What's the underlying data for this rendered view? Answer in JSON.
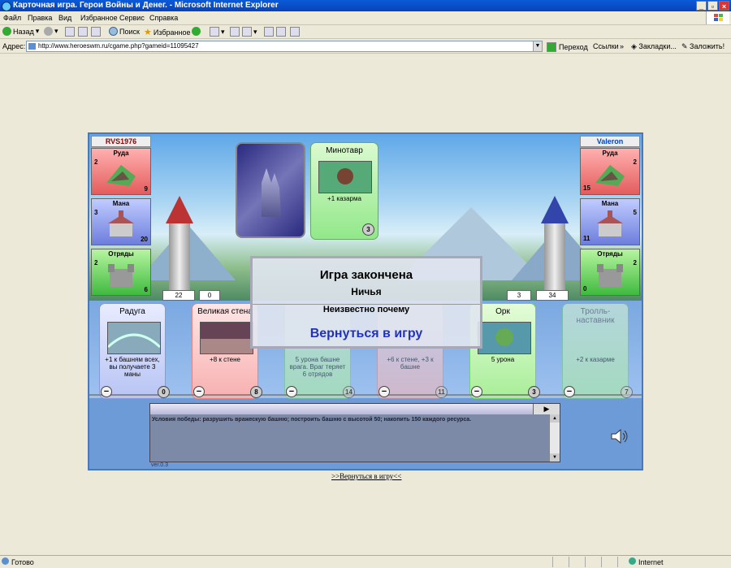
{
  "window": {
    "title": "Карточная игра. Герои Войны и Денег. - Microsoft Internet Explorer"
  },
  "menu": [
    "Файл",
    "Правка",
    "Вид",
    "Избранное",
    "Сервис",
    "Справка"
  ],
  "toolbar": {
    "back": "Назад",
    "search": "Поиск",
    "favorites": "Избранное"
  },
  "address": {
    "label": "Адрес:",
    "url": "http://www.heroeswm.ru/cgame.php?gameid=11095427",
    "go": "Переход",
    "links": "Ссылки",
    "bookmarks": "Закладки...",
    "bookmark_add": "Заложить!"
  },
  "status": {
    "text": "Готово",
    "zone": "Internet"
  },
  "game": {
    "left_player": {
      "name": "RVS1976",
      "resources": [
        {
          "name": "Руда",
          "income": "2",
          "amount": "9"
        },
        {
          "name": "Мана",
          "income": "3",
          "amount": "20"
        },
        {
          "name": "Отряды",
          "income": "2",
          "amount": "6"
        }
      ],
      "tower": "22",
      "wall": "0"
    },
    "right_player": {
      "name": "Valeron",
      "resources": [
        {
          "name": "Руда",
          "income": "2",
          "amount": "15"
        },
        {
          "name": "Мана",
          "income": "5",
          "amount": "11"
        },
        {
          "name": "Отряды",
          "income": "2",
          "amount": "0"
        }
      ],
      "wall": "3",
      "tower": "34"
    },
    "played_card": {
      "name": "Минотавр",
      "desc": "+1 казарма",
      "cost": "3"
    },
    "hand": [
      {
        "name": "Радуга",
        "desc": "+1 к башням всех, вы получаете 3 маны",
        "cost": "0",
        "color": "blue"
      },
      {
        "name": "Великая стена",
        "desc": "+8 к стене",
        "cost": "8",
        "color": "red"
      },
      {
        "name": "",
        "desc": "5 урона башне врага. Враг теряет 6 отрядов",
        "cost": "14",
        "color": "green"
      },
      {
        "name": "",
        "desc": "+6 к стене, +3 к башне",
        "cost": "11",
        "color": "red"
      },
      {
        "name": "Орк",
        "desc": "5 урона",
        "cost": "3",
        "color": "green"
      },
      {
        "name": "Тролль-наставник",
        "desc": "+2 к казарме",
        "cost": "7",
        "color": "green"
      }
    ],
    "log": "Условия победы: разрушить вражескую башню; построить башню с высотой 50; накопить 150 каждого ресурса.",
    "version": "ver.0.3",
    "dialog": {
      "title": "Игра закончена",
      "result": "Ничья",
      "reason": "Неизвестно почему",
      "return": "Вернуться в игру"
    }
  },
  "return_link": ">>Вернуться в игру<<"
}
